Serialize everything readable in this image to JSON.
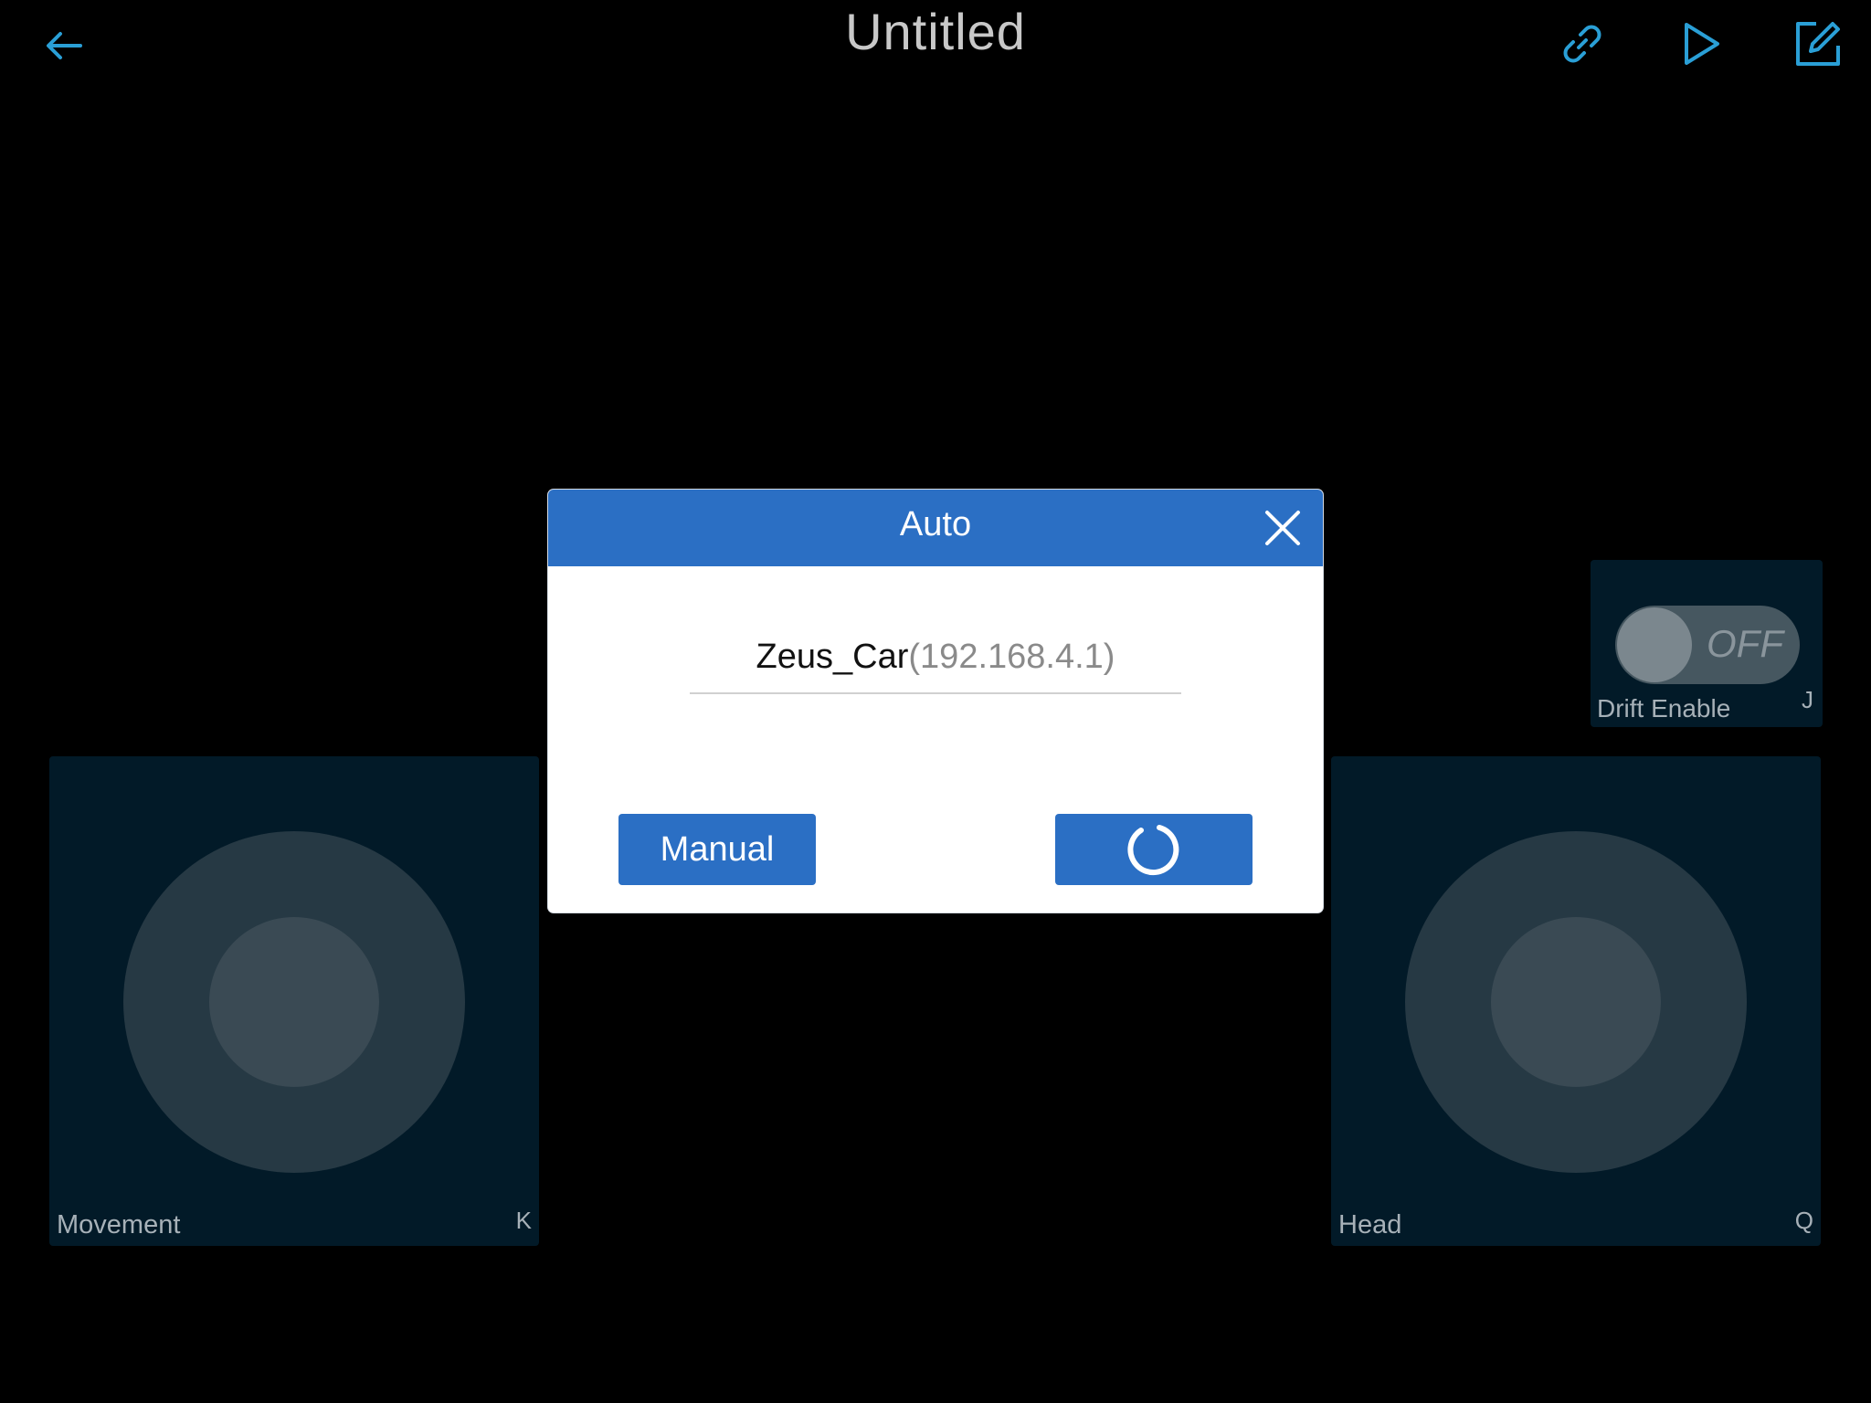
{
  "header": {
    "title": "Untitled",
    "back_icon": "arrow-left-icon",
    "actions": [
      "link-icon",
      "play-icon",
      "edit-icon"
    ],
    "accent_color": "#2a9fd6"
  },
  "widgets": {
    "drift": {
      "label": "Drift Enable",
      "key": "J",
      "state": "OFF"
    },
    "movement": {
      "label": "Movement",
      "key": "K"
    },
    "head": {
      "label": "Head",
      "key": "Q"
    }
  },
  "dialog": {
    "title": "Auto",
    "device_name": "Zeus_Car",
    "device_ip": "(192.168.4.1)",
    "manual_label": "Manual",
    "connect_state": "loading-spinner-icon",
    "header_color": "#2b6fc4"
  }
}
